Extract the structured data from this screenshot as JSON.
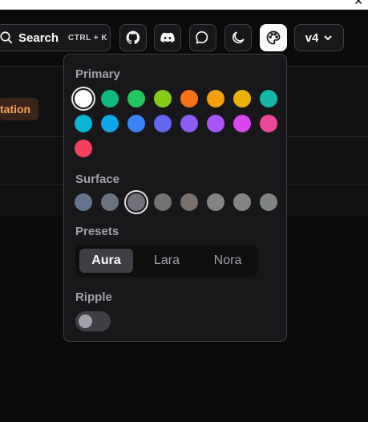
{
  "header": {
    "search_label": "Search",
    "search_shortcut": "CTRL + K",
    "version_label": "v4",
    "icons": [
      "github-icon",
      "discord-icon",
      "discussions-icon",
      "moon-icon",
      "palette-icon"
    ]
  },
  "background": {
    "badge_text": "tation"
  },
  "theme_picker": {
    "primary_title": "Primary",
    "primary_colors": [
      "#ffffff",
      "#10b981",
      "#22c55e",
      "#84cc16",
      "#f97316",
      "#f59e0b",
      "#eab308",
      "#14b8a6",
      "#06b6d4",
      "#0ea5e9",
      "#3b82f6",
      "#6366f1",
      "#8b5cf6",
      "#a855f7",
      "#d946ef",
      "#ec4899",
      "#f43f5e"
    ],
    "primary_selected": 0,
    "surface_title": "Surface",
    "surface_colors": [
      "#64748b",
      "#6b7280",
      "#71717a",
      "#737373",
      "#78716c",
      "#848484",
      "#858585",
      "#808483"
    ],
    "surface_selected": 2,
    "presets_title": "Presets",
    "presets": [
      "Aura",
      "Lara",
      "Nora"
    ],
    "preset_selected": "Aura",
    "ripple_title": "Ripple",
    "ripple_on": false
  }
}
